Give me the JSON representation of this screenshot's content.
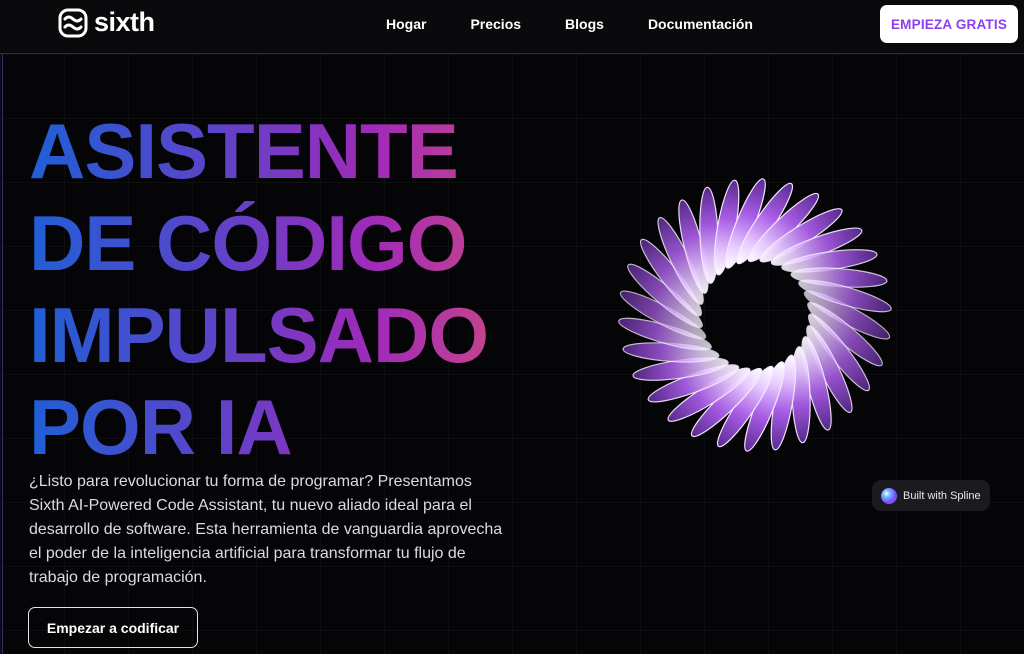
{
  "brand": {
    "name": "sixth"
  },
  "nav": {
    "links": [
      "Hogar",
      "Precios",
      "Blogs",
      "Documentación"
    ],
    "cta_label": "EMPIEZA GRATIS"
  },
  "hero": {
    "title_lines": [
      "ASISTENTE",
      "DE CÓDIGO",
      "IMPULSADO",
      "POR IA"
    ],
    "description": "¿Listo para revolucionar tu forma de programar? Presentamos Sixth AI-Powered Code Assistant, tu nuevo aliado ideal para el desarrollo de software. Esta herramienta de vanguardia aprovecha el poder de la inteligencia artificial para transformar tu flujo de trabajo de programación.",
    "cta_label": "Empezar a codificar"
  },
  "badge": {
    "label": "Built with Spline"
  },
  "colors": {
    "accent": "#8a3ff0",
    "gradient": [
      "#1f5fd6",
      "#5c44c9",
      "#a02ab9",
      "#c3438e"
    ],
    "background": "#050507"
  },
  "icons": {
    "logo": "wave-logo-icon",
    "spline": "spline-logo-icon",
    "ring": "3d-spiral-ring-graphic"
  }
}
